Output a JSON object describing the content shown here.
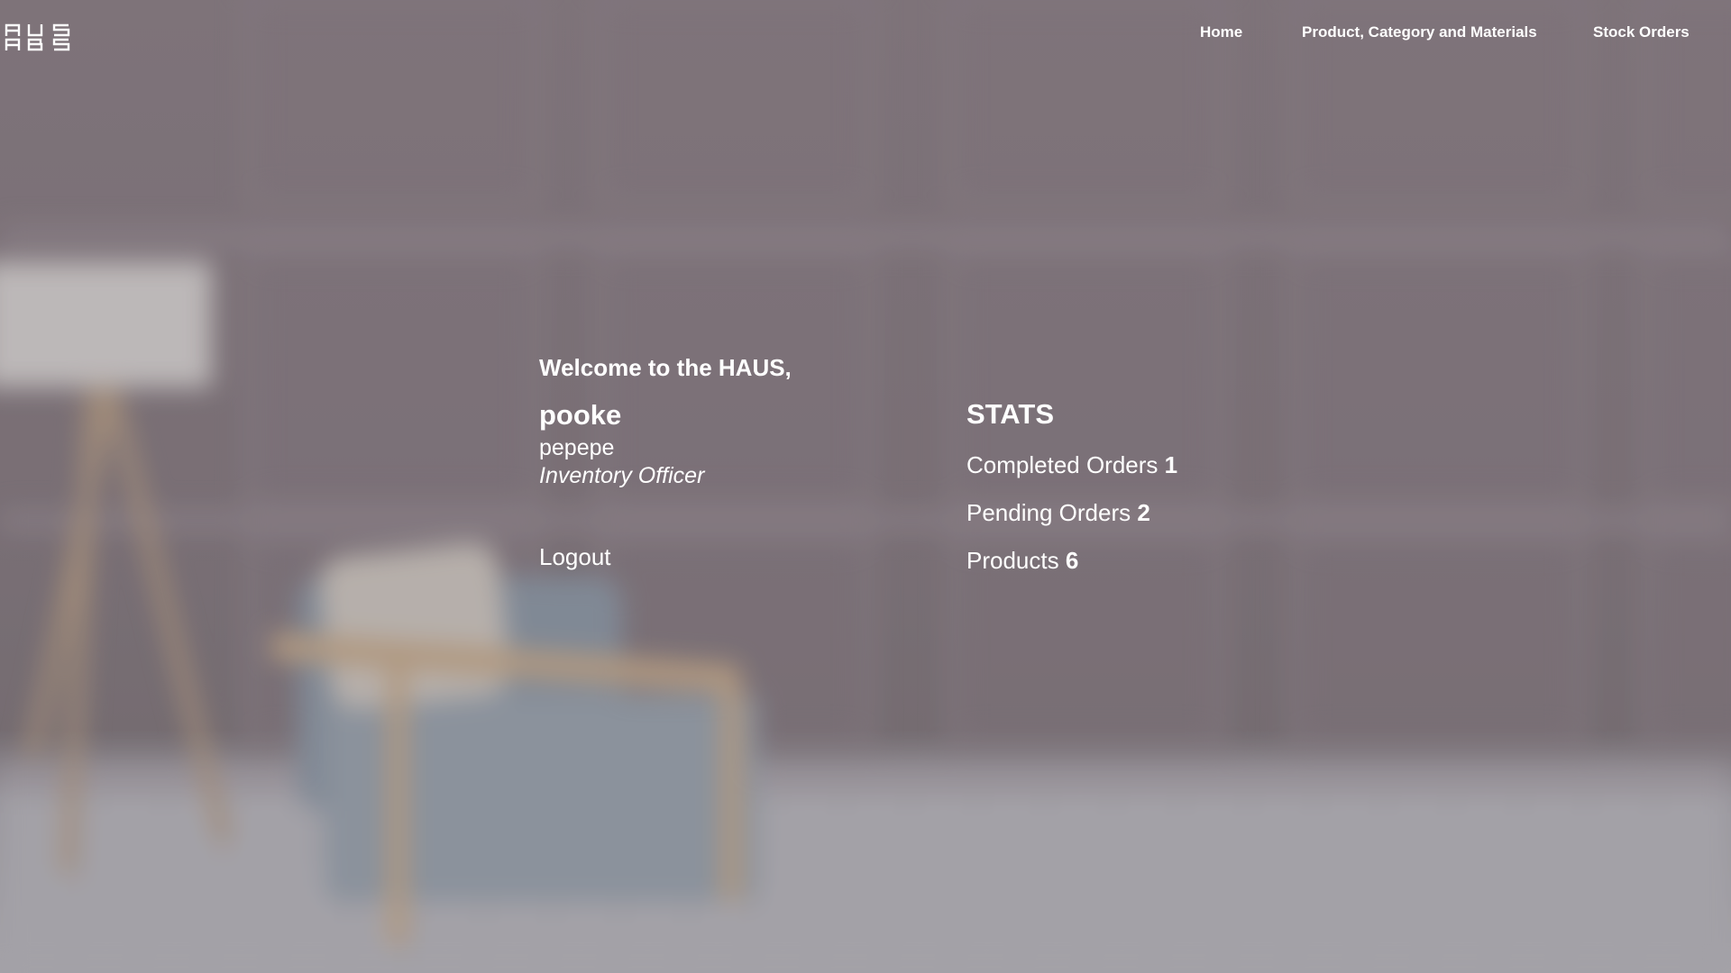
{
  "header": {
    "logo_alt": "HAUS",
    "nav": [
      {
        "label": "Home"
      },
      {
        "label": "Product, Category and Materials"
      },
      {
        "label": "Stock Orders"
      }
    ]
  },
  "welcome": {
    "greeting": "Welcome to the HAUS,",
    "username": "pooke",
    "full_name": "pepepe",
    "role": "Inventory Officer",
    "logout_label": "Logout"
  },
  "stats": {
    "title": "STATS",
    "rows": [
      {
        "label": "Completed Orders",
        "value": "1"
      },
      {
        "label": "Pending Orders",
        "value": "2"
      },
      {
        "label": "Products",
        "value": "6"
      }
    ]
  },
  "colors": {
    "text": "#ffffff",
    "wall": "#8a7f86",
    "floor": "#b7b7bd"
  },
  "icons": {
    "logo": "haus-logo"
  }
}
